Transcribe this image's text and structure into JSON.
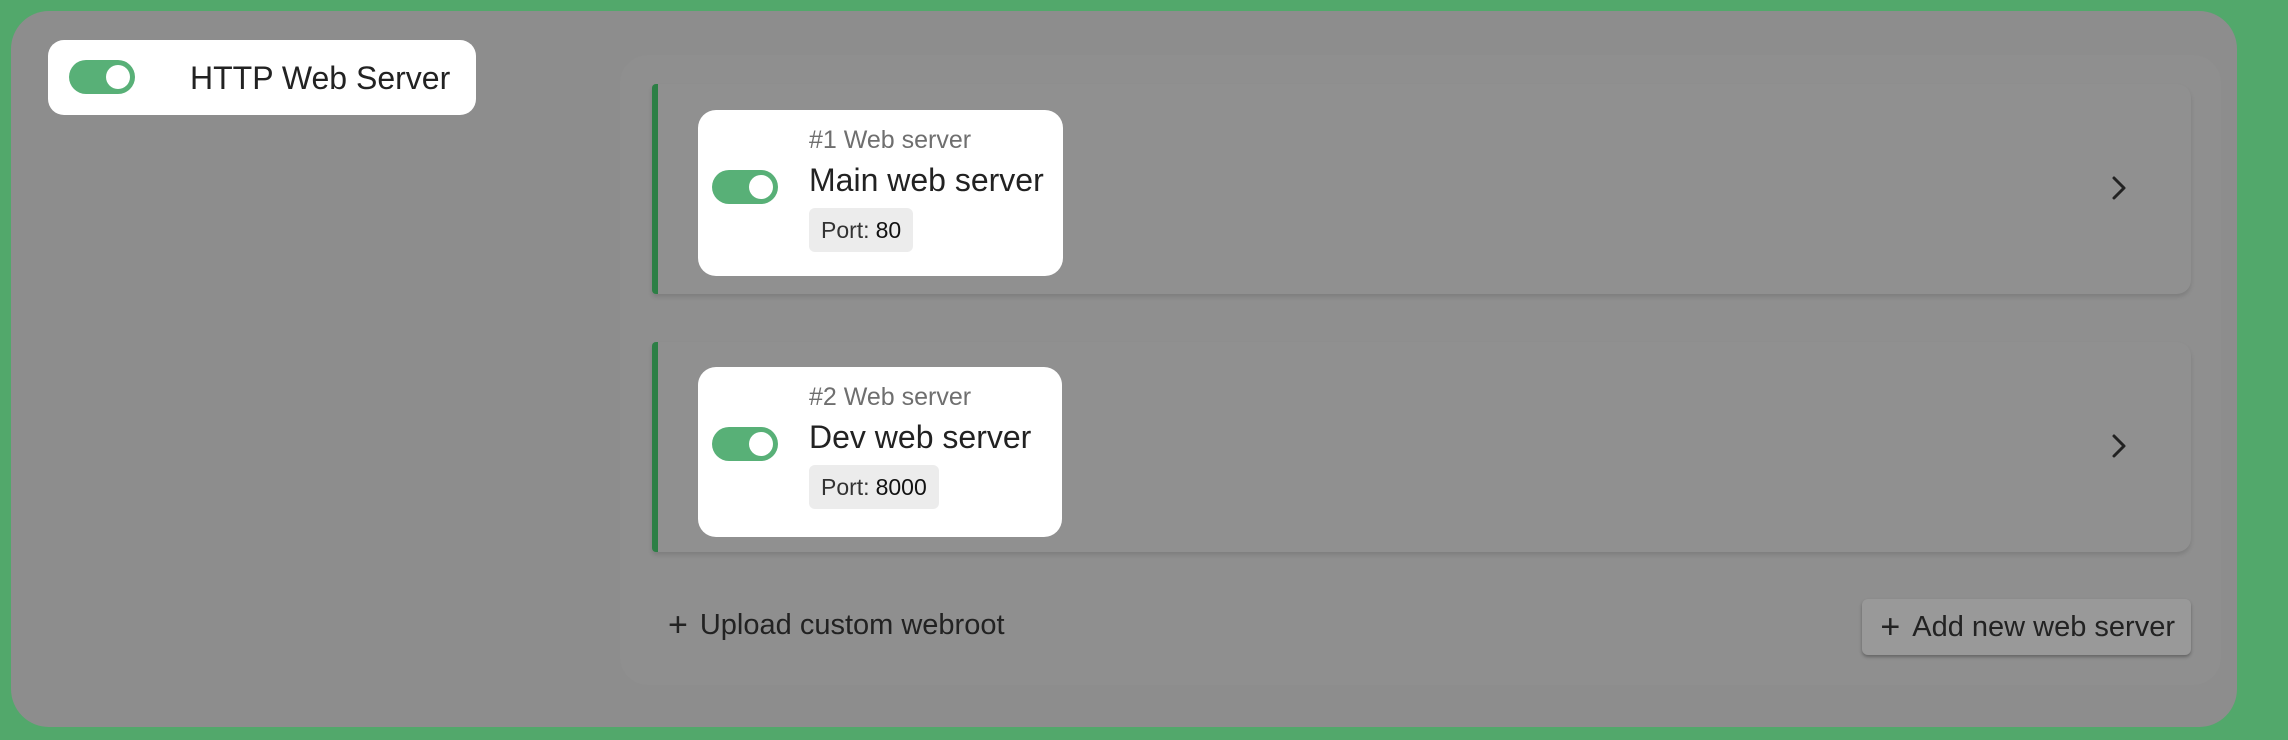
{
  "header": {
    "title": "HTTP Web Server",
    "toggle_on": true
  },
  "servers": [
    {
      "index_label": "#1 Web server",
      "name": "Main web server",
      "port_label": "Port:",
      "port_value": "80",
      "enabled": true
    },
    {
      "index_label": "#2 Web server",
      "name": "Dev web server",
      "port_label": "Port:",
      "port_value": "8000",
      "enabled": true
    }
  ],
  "actions": {
    "upload_label": "Upload custom webroot",
    "add_label": "Add new web server",
    "plus_icon": "+"
  },
  "icons": {
    "toggle": "toggle-switch-icon",
    "chevron": "chevron-right-icon",
    "plus": "plus-icon"
  },
  "colors": {
    "background": "#52a86b",
    "panel": "#8d8d8d",
    "toggle_on": "#58b077",
    "accent_border": "#2c7f45",
    "card": "#ffffff"
  }
}
